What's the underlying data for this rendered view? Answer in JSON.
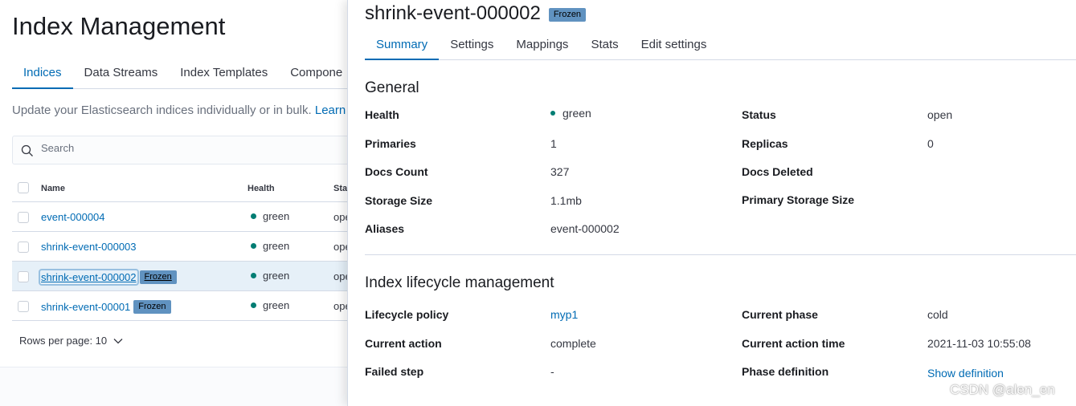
{
  "page": {
    "title": "Index Management",
    "tabs": [
      {
        "label": "Indices",
        "active": true
      },
      {
        "label": "Data Streams"
      },
      {
        "label": "Index Templates"
      },
      {
        "label": "Compone"
      }
    ],
    "description": "Update your Elasticsearch indices individually or in bulk.",
    "description_link": "Learn",
    "search_placeholder": "Search",
    "table": {
      "columns": [
        "Name",
        "Health",
        "Sta"
      ],
      "rows": [
        {
          "name": "event-000004",
          "health": "green",
          "status": "ope",
          "badge": ""
        },
        {
          "name": "shrink-event-000003",
          "health": "green",
          "status": "ope",
          "badge": ""
        },
        {
          "name": "shrink-event-000002",
          "health": "green",
          "status": "ope",
          "badge": "Frozen"
        },
        {
          "name": "shrink-event-00001",
          "health": "green",
          "status": "ope",
          "badge": "Frozen"
        }
      ]
    },
    "rows_per_page": "Rows per page: 10"
  },
  "flyout": {
    "title": "shrink-event-000002",
    "badge": "Frozen",
    "tabs": [
      "Summary",
      "Settings",
      "Mappings",
      "Stats",
      "Edit settings"
    ],
    "general": {
      "title": "General",
      "health_label": "Health",
      "health_value": "green",
      "status_label": "Status",
      "status_value": "open",
      "primaries_label": "Primaries",
      "primaries_value": "1",
      "replicas_label": "Replicas",
      "replicas_value": "0",
      "docs_count_label": "Docs Count",
      "docs_count_value": "327",
      "docs_deleted_label": "Docs Deleted",
      "storage_size_label": "Storage Size",
      "storage_size_value": "1.1mb",
      "primary_storage_label": "Primary Storage Size",
      "aliases_label": "Aliases",
      "aliases_value": "event-000002"
    },
    "ilm": {
      "title": "Index lifecycle management",
      "policy_label": "Lifecycle policy",
      "policy_value": "myp1",
      "phase_label": "Current phase",
      "phase_value": "cold",
      "action_label": "Current action",
      "action_value": "complete",
      "action_time_label": "Current action time",
      "action_time_value": "2021-11-03 10:55:08",
      "failed_step_label": "Failed step",
      "failed_step_value": "-",
      "phase_def_label": "Phase definition",
      "phase_def_link": "Show definition"
    }
  },
  "watermark": "CSDN @alen_en",
  "colors": {
    "accent": "#006bb4",
    "health_green": "#017d73",
    "frozen_badge": "#6092c0"
  }
}
